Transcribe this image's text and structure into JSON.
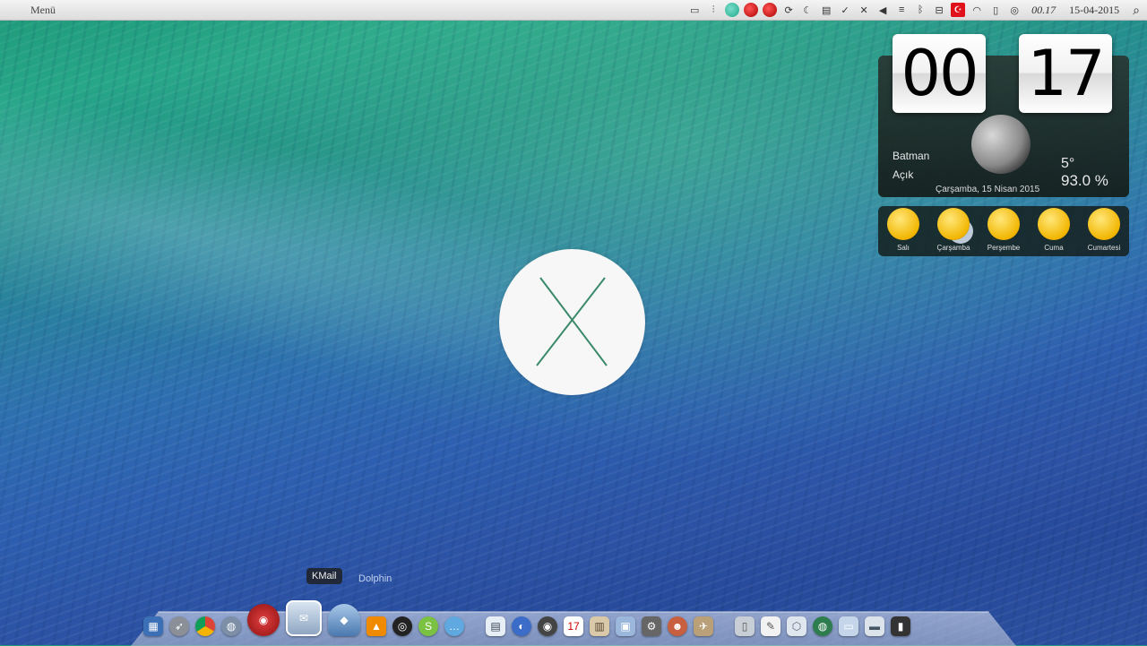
{
  "menubar": {
    "menu_label": "Menü",
    "clock": "00.17",
    "date": "15-04-2015"
  },
  "clock_widget": {
    "hours": "00",
    "minutes": "17",
    "city": "Batman",
    "condition": "Açık",
    "temperature": "5°",
    "humidity": "93.0 %",
    "date_long": "Çarşamba, 15 Nisan 2015",
    "forecast": [
      {
        "day": "Salı",
        "icon": "sun-icon"
      },
      {
        "day": "Çarşamba",
        "icon": "partly-cloudy-icon"
      },
      {
        "day": "Perşembe",
        "icon": "sun-icon"
      },
      {
        "day": "Cuma",
        "icon": "sun-icon"
      },
      {
        "day": "Cumartesi",
        "icon": "sun-icon"
      }
    ]
  },
  "dock": {
    "tooltip": "KMail",
    "tooltip2": "Dolphin"
  },
  "colors": {
    "menubar": "#e6e6e6",
    "logo_bg": "#f7f7f7",
    "logo_x": "#3a8a6a",
    "flag": "#e0111b"
  }
}
